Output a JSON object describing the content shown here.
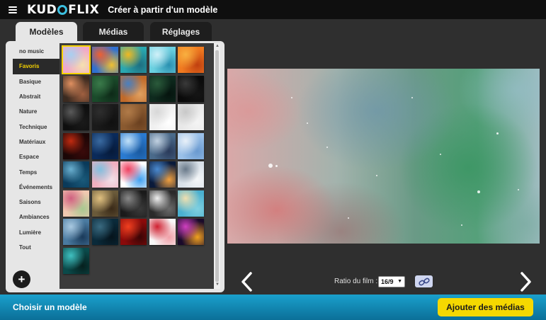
{
  "header": {
    "logo_text_1": "KUD",
    "logo_text_2": "FLIX",
    "title": "Créer à partir d'un modèle"
  },
  "tabs": [
    {
      "label": "Modèles",
      "active": true
    },
    {
      "label": "Médias",
      "active": false
    },
    {
      "label": "Réglages",
      "active": false
    }
  ],
  "categories": [
    {
      "label": "no music"
    },
    {
      "label": "Favoris",
      "active": true
    },
    {
      "label": "Basique"
    },
    {
      "label": "Abstrait"
    },
    {
      "label": "Nature"
    },
    {
      "label": "Technique"
    },
    {
      "label": "Matériaux"
    },
    {
      "label": "Espace"
    },
    {
      "label": "Temps"
    },
    {
      "label": "Événements"
    },
    {
      "label": "Saisons"
    },
    {
      "label": "Ambiances"
    },
    {
      "label": "Lumière"
    },
    {
      "label": "Tout"
    }
  ],
  "add_button": "+",
  "thumbnails": [
    {
      "name": "pastel-watercolor",
      "colors": [
        "#f0a8c8",
        "#a8d0f0",
        "#f5e0b0"
      ],
      "selected": true
    },
    {
      "name": "colorful-smoke",
      "colors": [
        "#3070d0",
        "#f06030",
        "#f0c030"
      ]
    },
    {
      "name": "teal-yellow-blocks",
      "colors": [
        "#2aa7b0",
        "#f0b820",
        "#1e6f80"
      ]
    },
    {
      "name": "cyan-waves",
      "colors": [
        "#6ad0e0",
        "#d0f0f8",
        "#2a90b0"
      ]
    },
    {
      "name": "orange-swirl",
      "colors": [
        "#f07a20",
        "#f8b040",
        "#c04010"
      ]
    },
    {
      "name": "autumn-bokeh",
      "colors": [
        "#3a2a20",
        "#e09060",
        "#a06040"
      ]
    },
    {
      "name": "green-leaves",
      "colors": [
        "#1a4a2a",
        "#3a7a4a",
        "#0e2a18"
      ]
    },
    {
      "name": "desert-canyon",
      "colors": [
        "#c06a2a",
        "#4a80c0",
        "#e0a060"
      ]
    },
    {
      "name": "dark-green-plants",
      "colors": [
        "#0e2a1e",
        "#2a5a3a",
        "#06140e"
      ]
    },
    {
      "name": "black-waves",
      "colors": [
        "#0a0a0a",
        "#3a3a3a",
        "#151515"
      ]
    },
    {
      "name": "black-silk",
      "colors": [
        "#0e0e0e",
        "#5a5a5a",
        "#1a1a1a"
      ]
    },
    {
      "name": "black-texture",
      "colors": [
        "#1a1a1a",
        "#2e2e2e",
        "#101010"
      ]
    },
    {
      "name": "wood-planks",
      "colors": [
        "#8a5a30",
        "#b07a48",
        "#6a4020"
      ]
    },
    {
      "name": "white-surface",
      "colors": [
        "#f0f0f0",
        "#d8d8d8",
        "#ffffff"
      ]
    },
    {
      "name": "crumpled-paper",
      "colors": [
        "#e8e8e8",
        "#c8c8c8",
        "#f4f4f4"
      ]
    },
    {
      "name": "red-particles",
      "colors": [
        "#1a0606",
        "#c02a10",
        "#3a0a0a"
      ]
    },
    {
      "name": "blue-night",
      "colors": [
        "#0a2a5a",
        "#3a6aa0",
        "#061a3a"
      ]
    },
    {
      "name": "blue-sky-clouds",
      "colors": [
        "#2a7ad0",
        "#c0e0f8",
        "#1a5aa0"
      ]
    },
    {
      "name": "stormy-clouds",
      "colors": [
        "#4a6a8a",
        "#c0d0e0",
        "#2a3a5a"
      ]
    },
    {
      "name": "light-blue-sky",
      "colors": [
        "#9ac0e8",
        "#e8f0f8",
        "#6a9ad0"
      ]
    },
    {
      "name": "blue-bokeh",
      "colors": [
        "#0a3a5a",
        "#6ab0d0",
        "#1a5a7a"
      ]
    },
    {
      "name": "balloons",
      "colors": [
        "#f0b0c0",
        "#80c0e0",
        "#f0e0e8"
      ]
    },
    {
      "name": "party-confetti",
      "colors": [
        "#ffffff",
        "#f04060",
        "#40a0f0"
      ]
    },
    {
      "name": "fireworks-blue",
      "colors": [
        "#0a1a3a",
        "#4a8ad0",
        "#f0a040"
      ]
    },
    {
      "name": "snowy-branches",
      "colors": [
        "#d8e0e8",
        "#6a7a8a",
        "#f4f6f8"
      ]
    },
    {
      "name": "pink-flowers",
      "colors": [
        "#f0c8b0",
        "#d06080",
        "#a8c890"
      ]
    },
    {
      "name": "golden-bokeh",
      "colors": [
        "#6a5a3a",
        "#e0c080",
        "#3a2a18"
      ]
    },
    {
      "name": "gray-gradient",
      "colors": [
        "#1a1a1a",
        "#8a8a8a",
        "#3a3a3a"
      ]
    },
    {
      "name": "silver-light",
      "colors": [
        "#2a2a2a",
        "#f0f0f0",
        "#6a6a6a"
      ]
    },
    {
      "name": "beach-sea",
      "colors": [
        "#4ab0d0",
        "#f0e0b0",
        "#80d0e0"
      ]
    },
    {
      "name": "winter-trees",
      "colors": [
        "#4a7aa0",
        "#a8c8e0",
        "#1a3a5a"
      ]
    },
    {
      "name": "dark-forest-blue",
      "colors": [
        "#0a2a3a",
        "#3a6a80",
        "#06141c"
      ]
    },
    {
      "name": "red-bokeh",
      "colors": [
        "#8a0a0a",
        "#f04020",
        "#3a0606"
      ]
    },
    {
      "name": "red-hearts",
      "colors": [
        "#f8f8f8",
        "#d02030",
        "#f0a0a8"
      ]
    },
    {
      "name": "neon-light-rays",
      "colors": [
        "#1a0a2a",
        "#d040c0",
        "#f0a020"
      ]
    },
    {
      "name": "teal-glow",
      "colors": [
        "#0a4a4a",
        "#40c0c0",
        "#06201e"
      ]
    }
  ],
  "preview": {
    "ratio_label": "Ratio du film :",
    "ratio_value": "16/9"
  },
  "icons": {
    "menu": "hamburger-icon",
    "prev": "chevron-left-icon",
    "next": "chevron-right-icon",
    "link": "link-icon",
    "add": "plus-icon"
  },
  "footer": {
    "title": "Choisir un modèle",
    "add_media": "Ajouter des médias"
  },
  "colors": {
    "accent": "#f5d800",
    "footer": "#1a9ccb",
    "logo_o": "#3cc0e0"
  }
}
